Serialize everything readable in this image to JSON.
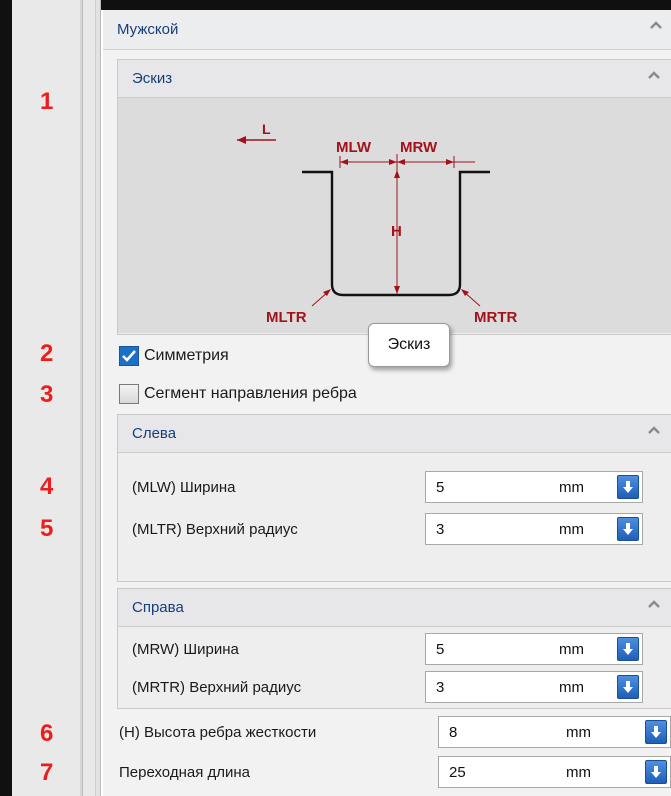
{
  "callouts": [
    "1",
    "2",
    "3",
    "4",
    "5",
    "6",
    "7"
  ],
  "section": {
    "title": "Мужской"
  },
  "sketch": {
    "title": "Эскиз",
    "labels": {
      "l": "L",
      "mlw": "MLW",
      "mrw": "MRW",
      "h": "H",
      "mltr": "MLTR",
      "mrtr": "MRTR"
    },
    "tooltip": "Эскиз",
    "accent_color": "#a3121b"
  },
  "checkboxes": {
    "symmetry": {
      "label": "Симметрия",
      "checked": true
    },
    "segment": {
      "label": "Сегмент направления ребра",
      "checked": false
    }
  },
  "left_group": {
    "title": "Слева",
    "rows": [
      {
        "label": "(MLW) Ширина",
        "value": "5",
        "unit": "mm"
      },
      {
        "label": "(MLTR) Верхний радиус",
        "value": "3",
        "unit": "mm"
      }
    ]
  },
  "right_group": {
    "title": "Справа",
    "rows": [
      {
        "label": "(MRW) Ширина",
        "value": "5",
        "unit": "mm"
      },
      {
        "label": "(MRTR) Верхний радиус",
        "value": "3",
        "unit": "mm"
      }
    ]
  },
  "height_row": {
    "label": "(H) Высота ребра жесткости",
    "value": "8",
    "unit": "mm"
  },
  "transition_row": {
    "label": "Переходная длина",
    "value": "25",
    "unit": "mm"
  }
}
